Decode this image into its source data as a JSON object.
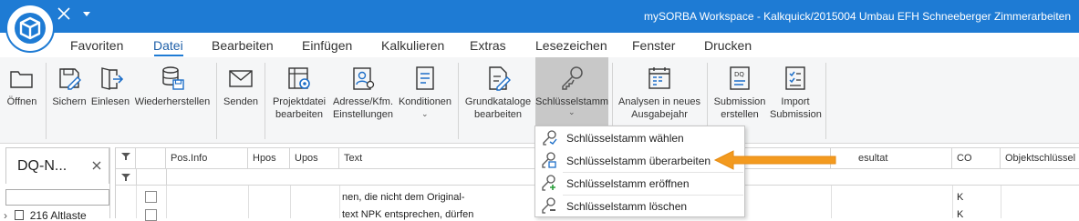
{
  "window": {
    "title": "mySORBA Workspace - Kalkquick/2015004 Umbau EFH Schneeberger Zimmerarbeiten"
  },
  "menu": {
    "items": [
      "Favoriten",
      "Datei",
      "Bearbeiten",
      "Einfügen",
      "Kalkulieren",
      "Extras",
      "Lesezeichen",
      "Fenster",
      "Drucken"
    ],
    "active": "Datei"
  },
  "ribbon": {
    "buttons": [
      {
        "label": "Öffnen",
        "icon": "folder-open-icon"
      },
      {
        "label": "Sichern",
        "icon": "save-edit-icon"
      },
      {
        "label": "Einlesen",
        "icon": "import-icon"
      },
      {
        "label": "Wiederherstellen",
        "icon": "database-restore-icon"
      },
      {
        "label": "Senden",
        "icon": "mail-icon"
      },
      {
        "label": "Projektdatei\nbearbeiten",
        "icon": "project-settings-icon"
      },
      {
        "label": "Adresse/Kfm.\nEinstellungen",
        "icon": "address-settings-icon"
      },
      {
        "label": "Konditionen",
        "icon": "conditions-icon"
      },
      {
        "label": "Grundkataloge\nbearbeiten",
        "icon": "catalog-edit-icon"
      },
      {
        "label": "Schlüsselstamm",
        "icon": "key-icon"
      },
      {
        "label": "Analysen in neues\nAusgabejahr",
        "icon": "calendar-analysis-icon"
      },
      {
        "label": "Submission\nerstellen",
        "icon": "submission-create-icon"
      },
      {
        "label": "Import\nSubmission",
        "icon": "submission-import-icon"
      }
    ]
  },
  "left_panel": {
    "title": "DQ-N...",
    "tree_row": "216 Altlaste"
  },
  "grid": {
    "columns": [
      "Pos.Info",
      "Hpos",
      "Upos",
      "Text",
      "esultat",
      "CO",
      "Objektschlüssel"
    ],
    "rows": [
      {
        "text": "nen, die nicht dem Original-",
        "co": "K"
      },
      {
        "text": "text NPK entsprechen, dürfen",
        "co": "K"
      }
    ]
  },
  "dropdown": {
    "items": [
      {
        "label": "Schlüsselstamm wählen",
        "icon": "key-select-icon"
      },
      {
        "label": "Schlüsselstamm überarbeiten",
        "icon": "key-edit-icon"
      },
      {
        "label": "Schlüsselstamm eröffnen",
        "icon": "key-add-icon"
      },
      {
        "label": "Schlüsselstamm löschen",
        "icon": "key-delete-icon"
      }
    ]
  },
  "colors": {
    "titlebar": "#1e7bd4",
    "arrow": "#f39a1f",
    "pressed": "#c8c8c8"
  }
}
